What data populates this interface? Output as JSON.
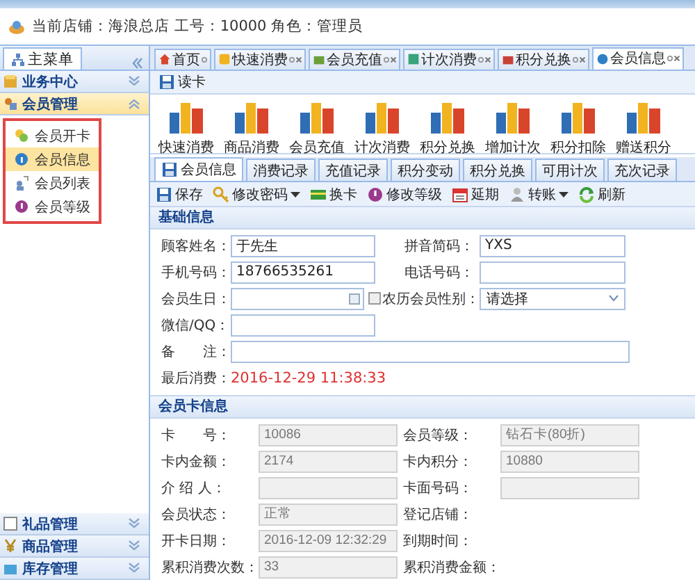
{
  "header": {
    "store_info": "当前店铺：海浪总店 工号：10000 角色：管理员"
  },
  "sidebar": {
    "title": "主菜单",
    "groups": [
      {
        "label": "业务中心",
        "expanded": false
      },
      {
        "label": "会员管理",
        "expanded": true,
        "children": [
          {
            "label": "会员开卡",
            "selected": false
          },
          {
            "label": "会员信息",
            "selected": true
          },
          {
            "label": "会员列表",
            "selected": false
          },
          {
            "label": "会员等级",
            "selected": false
          }
        ]
      },
      {
        "label": "礼品管理",
        "expanded": false
      },
      {
        "label": "商品管理",
        "expanded": false
      },
      {
        "label": "库存管理",
        "expanded": false
      }
    ]
  },
  "tabs": [
    {
      "label": "首页",
      "selected": false,
      "closable": false
    },
    {
      "label": "快速消费",
      "selected": false,
      "closable": true
    },
    {
      "label": "会员充值",
      "selected": false,
      "closable": true
    },
    {
      "label": "计次消费",
      "selected": false,
      "closable": true
    },
    {
      "label": "积分兑换",
      "selected": false,
      "closable": true
    },
    {
      "label": "会员信息",
      "selected": true,
      "closable": true
    }
  ],
  "toolbar": {
    "read_card": "读卡"
  },
  "quick_actions": [
    "快速消费",
    "商品消费",
    "会员充值",
    "计次消费",
    "积分兑换",
    "增加计次",
    "积分扣除",
    "赠送积分"
  ],
  "subtabs": [
    {
      "label": "会员信息",
      "selected": true
    },
    {
      "label": "消费记录",
      "selected": false
    },
    {
      "label": "充值记录",
      "selected": false
    },
    {
      "label": "积分变动",
      "selected": false
    },
    {
      "label": "积分兑换",
      "selected": false
    },
    {
      "label": "可用计次",
      "selected": false
    },
    {
      "label": "充次记录",
      "selected": false
    }
  ],
  "actions": [
    {
      "label": "保存",
      "dropdown": false
    },
    {
      "label": "修改密码",
      "dropdown": true
    },
    {
      "label": "换卡",
      "dropdown": false
    },
    {
      "label": "修改等级",
      "dropdown": false
    },
    {
      "label": "延期",
      "dropdown": false
    },
    {
      "label": "转账",
      "dropdown": true
    },
    {
      "label": "刷新",
      "dropdown": false
    }
  ],
  "basic_info": {
    "title": "基础信息",
    "rows": [
      [
        {
          "label": "顾客姓名：",
          "kind": "text",
          "value": "于先生"
        },
        {
          "label": "拼音简码：",
          "kind": "text",
          "value": "YXS"
        }
      ],
      [
        {
          "label": "手机号码：",
          "kind": "text",
          "value": "18766535261"
        },
        {
          "label": "电话号码：",
          "kind": "text"
        }
      ],
      [
        {
          "label": "会员生日：",
          "kind": "date",
          "lunar": {
            "label": "农历",
            "checked": false
          }
        },
        {
          "label": "会员性别：",
          "kind": "select",
          "value": "请选择"
        }
      ],
      [
        {
          "label": "微信/QQ：",
          "kind": "text"
        }
      ],
      [
        {
          "label": "备　　注：",
          "kind": "wide"
        }
      ],
      [
        {
          "label": "最后消费：",
          "kind": "highlight",
          "value": "2016-12-29 11:38:33"
        }
      ]
    ]
  },
  "card_info": {
    "title": "会员卡信息",
    "rows": [
      [
        {
          "label": "卡　　号：",
          "kind": "readonly",
          "value": "10086"
        },
        {
          "label": "会员等级：",
          "kind": "readonly",
          "value": "钻石卡(80折)"
        }
      ],
      [
        {
          "label": "卡内金额：",
          "kind": "readonly",
          "value": "2174"
        },
        {
          "label": "卡内积分：",
          "kind": "readonly",
          "value": "10880"
        }
      ],
      [
        {
          "label": "介 绍 人：",
          "kind": "readonly"
        },
        {
          "label": "卡面号码：",
          "kind": "readonly"
        }
      ],
      [
        {
          "label": "会员状态：",
          "kind": "readonly",
          "value": "正常"
        },
        {
          "label": "登记店铺：",
          "kind": "none"
        }
      ],
      [
        {
          "label": "开卡日期：",
          "kind": "readonly",
          "value": "2016-12-09 12:32:29"
        },
        {
          "label": "到期时间：",
          "kind": "none"
        }
      ],
      [
        {
          "label": "累积消费次数：",
          "kind": "readonly",
          "value": "33"
        },
        {
          "label": "累积消费金额：",
          "kind": "none"
        }
      ]
    ]
  }
}
